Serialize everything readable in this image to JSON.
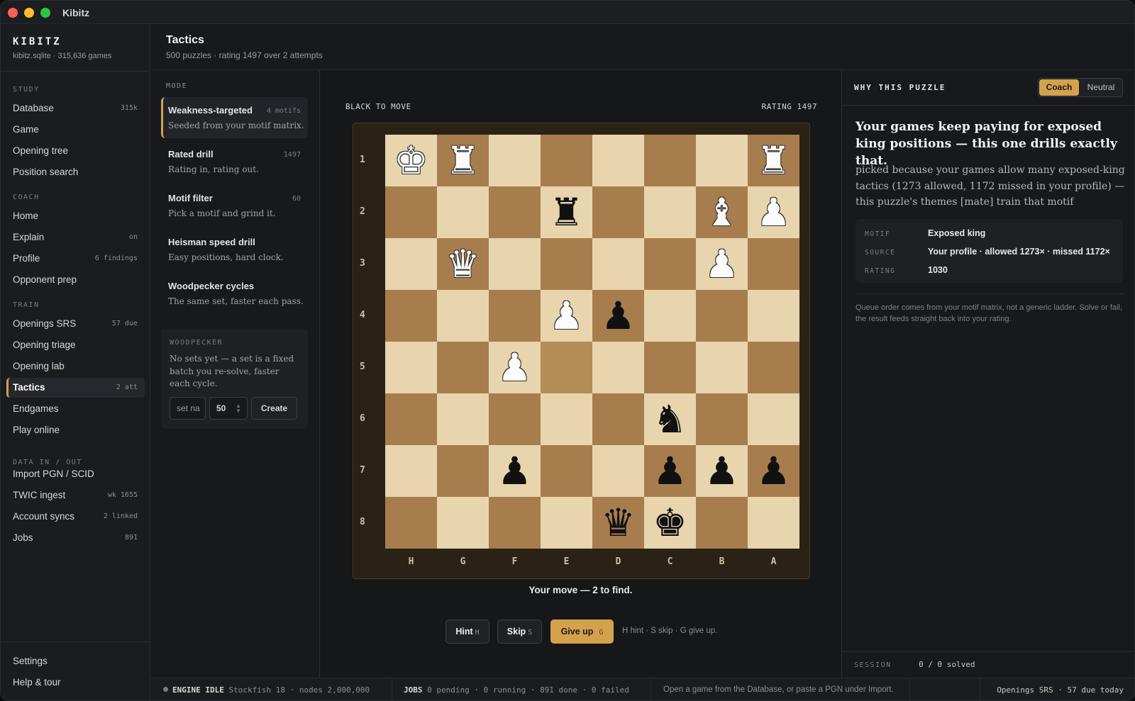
{
  "window": {
    "title": "Kibitz"
  },
  "brand": {
    "name": "KIBITZ",
    "sub": "kibitz.sqlite · 315,636 games"
  },
  "sidebar": {
    "sections": [
      {
        "label": "STUDY"
      },
      {
        "label": "COACH"
      },
      {
        "label": "TRAIN"
      },
      {
        "label": "DATA IN / OUT"
      }
    ],
    "items": [
      {
        "label": "Database",
        "badge": "315k"
      },
      {
        "label": "Game",
        "badge": ""
      },
      {
        "label": "Opening tree",
        "badge": ""
      },
      {
        "label": "Position search",
        "badge": ""
      },
      {
        "label": "Home",
        "badge": ""
      },
      {
        "label": "Explain",
        "badge": "on"
      },
      {
        "label": "Profile",
        "badge": "6 findings"
      },
      {
        "label": "Opponent prep",
        "badge": ""
      },
      {
        "label": "Openings SRS",
        "badge": "57 due"
      },
      {
        "label": "Opening triage",
        "badge": ""
      },
      {
        "label": "Opening lab",
        "badge": ""
      },
      {
        "label": "Tactics",
        "badge": "2 att"
      },
      {
        "label": "Endgames",
        "badge": ""
      },
      {
        "label": "Play online",
        "badge": ""
      },
      {
        "label": "Import PGN / SCID",
        "badge": ""
      },
      {
        "label": "TWIC ingest",
        "badge": "wk 1655"
      },
      {
        "label": "Account syncs",
        "badge": "2 linked"
      },
      {
        "label": "Jobs",
        "badge": "891"
      }
    ],
    "bottom": [
      {
        "label": "Settings"
      },
      {
        "label": "Help & tour"
      }
    ]
  },
  "header": {
    "title": "Tactics",
    "subtitle": "500 puzzles · rating 1497 over 2 attempts"
  },
  "modes": {
    "header": "MODE",
    "items": [
      {
        "title": "Weakness-targeted",
        "count": "4 motifs",
        "desc": "Seeded from your motif matrix."
      },
      {
        "title": "Rated drill",
        "count": "1497",
        "desc": "Rating in, rating out."
      },
      {
        "title": "Motif filter",
        "count": "60",
        "desc": "Pick a motif and grind it."
      },
      {
        "title": "Heisman speed drill",
        "count": "",
        "desc": "Easy positions, hard clock."
      },
      {
        "title": "Woodpecker cycles",
        "count": "",
        "desc": "The same set, faster each pass."
      }
    ]
  },
  "woodpecker": {
    "header": "WOODPECKER",
    "body": "No sets yet — a set is a fixed batch you re-solve, faster each cycle.",
    "name_placeholder": "set na",
    "size_value": "50",
    "create_label": "Create"
  },
  "board": {
    "to_move": "BLACK TO MOVE",
    "rating": "RATING 1497",
    "ranks": [
      "1",
      "2",
      "3",
      "4",
      "5",
      "6",
      "7",
      "8"
    ],
    "files": [
      "H",
      "G",
      "F",
      "E",
      "D",
      "C",
      "B",
      "A"
    ],
    "pieces": [
      {
        "square": "h1",
        "glyph": "♚",
        "color": "white",
        "name": "king"
      },
      {
        "square": "g1",
        "glyph": "♜",
        "color": "white",
        "name": "rook"
      },
      {
        "square": "a1",
        "glyph": "♜",
        "color": "white",
        "name": "rook"
      },
      {
        "square": "e2",
        "glyph": "♜",
        "color": "black",
        "name": "rook"
      },
      {
        "square": "b2",
        "glyph": "♝",
        "color": "white",
        "name": "bishop"
      },
      {
        "square": "a2",
        "glyph": "♟",
        "color": "white",
        "name": "pawn"
      },
      {
        "square": "g3",
        "glyph": "♛",
        "color": "white",
        "name": "queen"
      },
      {
        "square": "b3",
        "glyph": "♟",
        "color": "white",
        "name": "pawn"
      },
      {
        "square": "e4",
        "glyph": "♟",
        "color": "white",
        "name": "pawn"
      },
      {
        "square": "d4",
        "glyph": "♟",
        "color": "black",
        "name": "pawn"
      },
      {
        "square": "f5",
        "glyph": "♟",
        "color": "white",
        "name": "pawn"
      },
      {
        "square": "c6",
        "glyph": "♞",
        "color": "black",
        "name": "knight"
      },
      {
        "square": "f7",
        "glyph": "♟",
        "color": "black",
        "name": "pawn"
      },
      {
        "square": "c7",
        "glyph": "♟",
        "color": "black",
        "name": "pawn"
      },
      {
        "square": "b7",
        "glyph": "♟",
        "color": "black",
        "name": "pawn"
      },
      {
        "square": "a7",
        "glyph": "♟",
        "color": "black",
        "name": "pawn"
      },
      {
        "square": "d8",
        "glyph": "♛",
        "color": "black",
        "name": "queen"
      },
      {
        "square": "c8",
        "glyph": "♚",
        "color": "black",
        "name": "king"
      }
    ],
    "highlight": "e5",
    "colors": {
      "light": "#e8d5ad",
      "dark": "#a87d4e",
      "accent": "#d4a24c"
    }
  },
  "status": "Your move — 2 to find.",
  "actions": {
    "hint": {
      "label": "Hint",
      "key": "H"
    },
    "skip": {
      "label": "Skip",
      "key": "S"
    },
    "giveup": {
      "label": "Give up",
      "key": "G"
    },
    "keys_hint": "H hint · S skip · G give up."
  },
  "why": {
    "header": "WHY THIS PUZZLE",
    "toggle": {
      "coach": "Coach",
      "neutral": "Neutral"
    },
    "headline": "Your games keep paying for exposed king positions — this one drills exactly that.",
    "reason": "picked because your games allow many exposed-king tactics (1273 allowed, 1172 missed in your profile) — this puzzle's themes [mate] train that motif",
    "facts": [
      {
        "key": "MOTIF",
        "value": "Exposed king"
      },
      {
        "key": "SOURCE",
        "value": "Your profile · allowed 1273× · missed 1172×"
      },
      {
        "key": "RATING",
        "value": "1030"
      }
    ],
    "note": "Queue order comes from your motif matrix, not a generic ladder. Solve or fail, the result feeds straight back into your rating.",
    "session_label": "SESSION",
    "session_value": "0 / 0 solved"
  },
  "footer": {
    "engine_label": "ENGINE IDLE",
    "engine_detail": "Stockfish 18 · nodes 2,000,000",
    "jobs_label": "JOBS",
    "jobs_detail": "0 pending · 0 running · 891 done · 0 failed",
    "message": "Open a game from the Database, or paste a PGN under Import.",
    "srs": "Openings SRS · 57 due today"
  }
}
